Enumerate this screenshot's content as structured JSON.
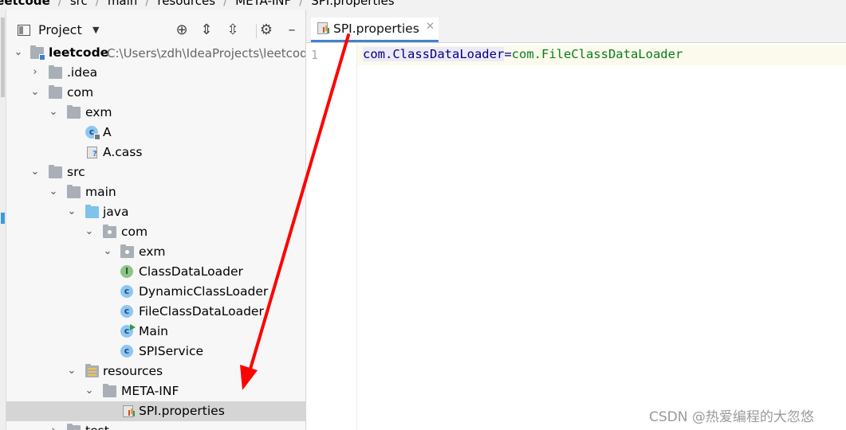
{
  "breadcrumb": {
    "items": [
      "leetcode",
      "src",
      "main",
      "resources",
      "META-INF",
      "SPI.properties"
    ]
  },
  "project_panel": {
    "title": "Project",
    "project_path": "C:\\Users\\zdh\\IdeaProjects\\leetcod",
    "tree": [
      {
        "label": "leetcode",
        "bold": true,
        "level": 0,
        "arrow": "down",
        "icon": "module-folder-icon"
      },
      {
        "label": ".idea",
        "level": 1,
        "arrow": "right",
        "icon": "folder-icon"
      },
      {
        "label": "com",
        "level": 1,
        "arrow": "down",
        "icon": "folder-icon"
      },
      {
        "label": "exm",
        "level": 2,
        "arrow": "down",
        "icon": "folder-icon"
      },
      {
        "label": "A",
        "level": 3,
        "arrow": "",
        "icon": "class-icon"
      },
      {
        "label": "A.cass",
        "level": 3,
        "arrow": "",
        "icon": "unknown-file-icon"
      },
      {
        "label": "src",
        "level": 1,
        "arrow": "down",
        "icon": "folder-icon"
      },
      {
        "label": "main",
        "level": 2,
        "arrow": "down",
        "icon": "folder-icon"
      },
      {
        "label": "java",
        "level": 3,
        "arrow": "down",
        "icon": "source-folder-icon"
      },
      {
        "label": "com",
        "level": 4,
        "arrow": "down",
        "icon": "package-icon"
      },
      {
        "label": "exm",
        "level": 5,
        "arrow": "down",
        "icon": "package-icon"
      },
      {
        "label": "ClassDataLoader",
        "level": 6,
        "arrow": "",
        "icon": "interface-icon"
      },
      {
        "label": "DynamicClassLoader",
        "level": 6,
        "arrow": "",
        "icon": "class-icon"
      },
      {
        "label": "FileClassDataLoader",
        "level": 6,
        "arrow": "",
        "icon": "class-icon"
      },
      {
        "label": "Main",
        "level": 6,
        "arrow": "",
        "icon": "main-class-icon"
      },
      {
        "label": "SPIService",
        "level": 6,
        "arrow": "",
        "icon": "class-icon"
      },
      {
        "label": "resources",
        "level": 3,
        "arrow": "down",
        "icon": "resources-folder-icon"
      },
      {
        "label": "META-INF",
        "level": 4,
        "arrow": "down",
        "icon": "folder-icon"
      },
      {
        "label": "SPI.properties",
        "level": 5,
        "arrow": "",
        "icon": "properties-file-icon",
        "selected": true
      },
      {
        "label": "test",
        "level": 2,
        "arrow": "right",
        "icon": "folder-icon"
      }
    ]
  },
  "editor": {
    "tab_label": "SPI.properties",
    "line_number": "1",
    "code_key": "com.ClassDataLoader",
    "code_eq": "=",
    "code_value": "com.FileClassDataLoader"
  },
  "watermark": "CSDN @热爱编程的大忽悠",
  "colors": {
    "selection": "#d5d5d5",
    "tab_underline": "#4083c9",
    "arrow": "#ff0000",
    "code_value": "#067d17",
    "code_key": "#000080"
  }
}
